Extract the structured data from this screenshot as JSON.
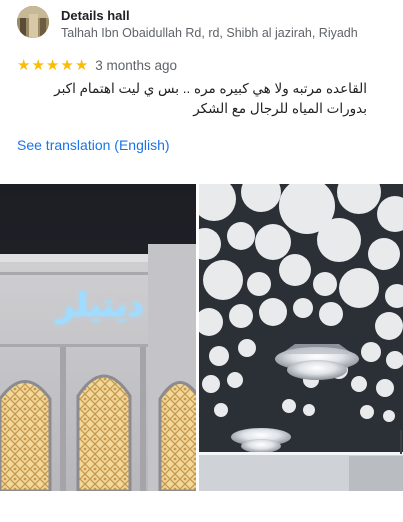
{
  "place": {
    "name": "Details hall",
    "address": "Talhah Ibn Obaidullah Rd, rd, Shibh al jazirah, Riyadh"
  },
  "review": {
    "rating": 5,
    "time_ago": "3 months ago",
    "text": "القاعده مرتبه ولا هي كبيره مره .. بس ي ليت اهتمام اكبر بدورات المياه للرجال مع الشكر",
    "see_translation": "See translation (English)"
  },
  "photos": {
    "left_sign_text": "ديتيلر",
    "left_icon": "hall-facade-photo",
    "right_icon": "ceiling-chandelier-photo"
  },
  "colors": {
    "star": "#fbbc04",
    "link": "#1a73e8",
    "sign_glow": "#6fc4ff"
  }
}
